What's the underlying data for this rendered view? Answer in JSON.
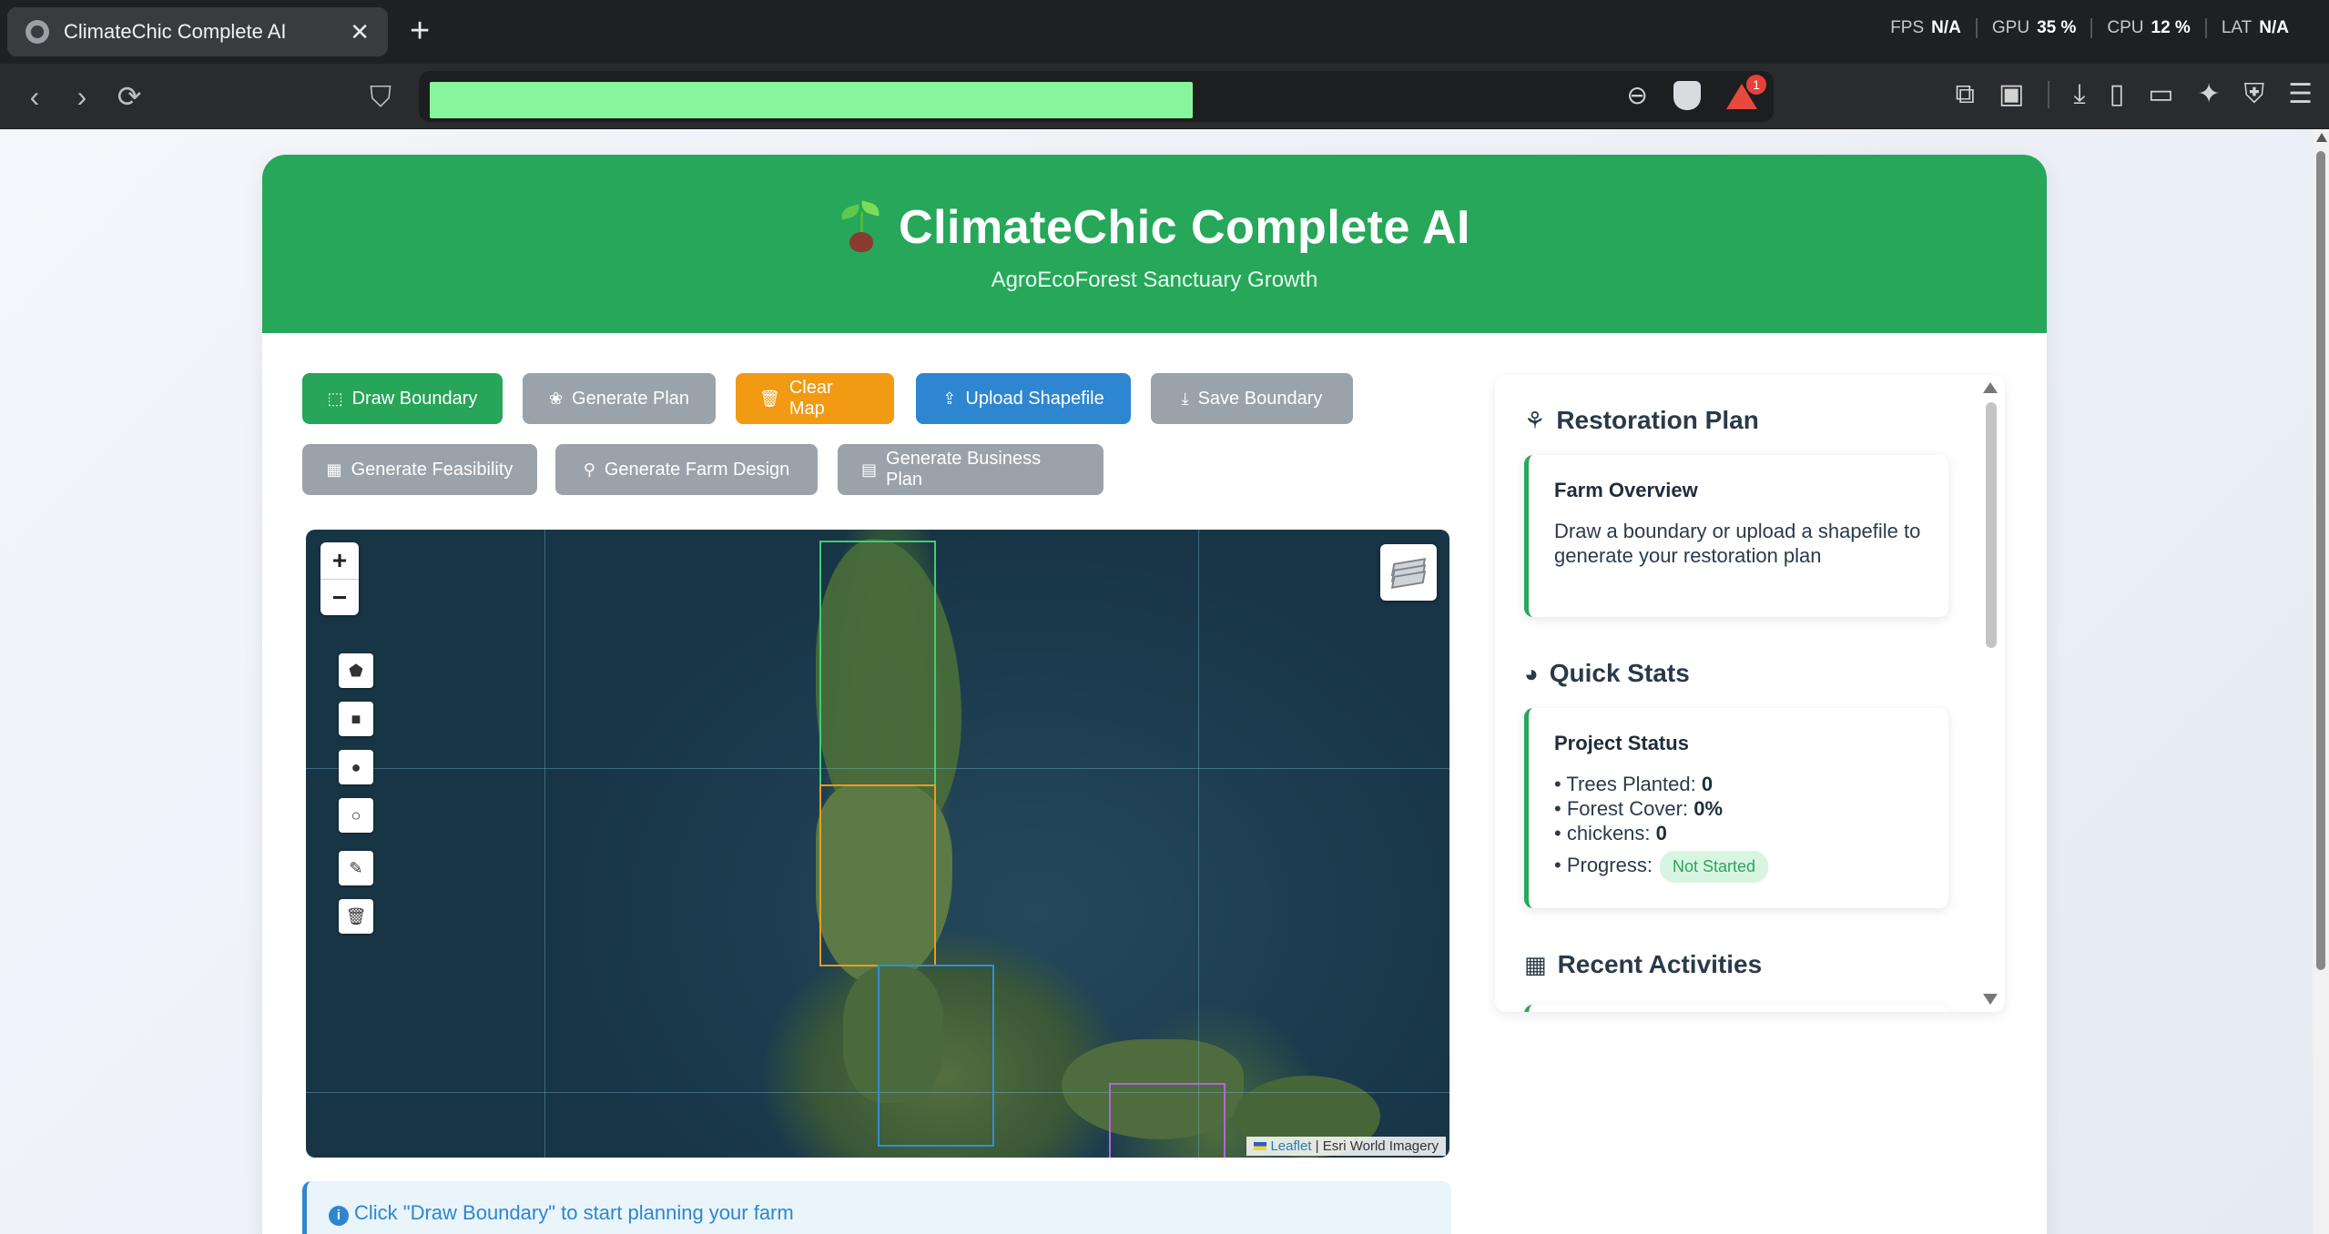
{
  "browser": {
    "tab_title": "ClimateChic Complete AI",
    "tab_close": "✕",
    "new_tab": "+",
    "perf": [
      {
        "label": "FPS",
        "value": "N/A"
      },
      {
        "label": "GPU",
        "value": "35 %"
      },
      {
        "label": "CPU",
        "value": "12 %"
      },
      {
        "label": "LAT",
        "value": "N/A"
      }
    ],
    "rewards_badge": "1"
  },
  "header": {
    "title": "ClimateChic Complete AI",
    "subtitle": "AgroEcoForest Sanctuary Growth"
  },
  "toolbar": {
    "draw_boundary": "Draw Boundary",
    "generate_plan": "Generate Plan",
    "clear_map": "Clear Map",
    "upload_shapefile": "Upload Shapefile",
    "save_boundary": "Save Boundary",
    "generate_feasibility": "Generate Feasibility",
    "generate_farm_design": "Generate Farm Design",
    "generate_business_plan": "Generate Business Plan"
  },
  "map": {
    "zoom_in": "+",
    "zoom_out": "−",
    "attribution_link": "Leaflet",
    "attribution_text": "| Esri World Imagery",
    "tile_colors": {
      "green": "#3ecf72",
      "orange": "#f29a1c",
      "blue": "#2e90d6",
      "purple": "#b565d8"
    }
  },
  "hint": {
    "text": "Click \"Draw Boundary\" to start planning your farm"
  },
  "sidebar": {
    "restoration_title": "Restoration Plan",
    "farm_overview_title": "Farm Overview",
    "farm_overview_text": "Draw a boundary or upload a shapefile to generate your restoration plan",
    "quick_stats_title": "Quick Stats",
    "project_status_title": "Project Status",
    "stats": {
      "trees_label": "• Trees Planted:",
      "trees_value": "0",
      "forest_label": "• Forest Cover:",
      "forest_value": "0%",
      "chickens_label": "• chickens:",
      "chickens_value": "0",
      "progress_label": "• Progress:",
      "progress_value": "Not Started"
    },
    "recent_title": "Recent Activities"
  },
  "colors": {
    "brand_green": "#26a75a",
    "orange": "#f19a12",
    "blue": "#2e86d1",
    "gray": "#9aa3a9"
  }
}
